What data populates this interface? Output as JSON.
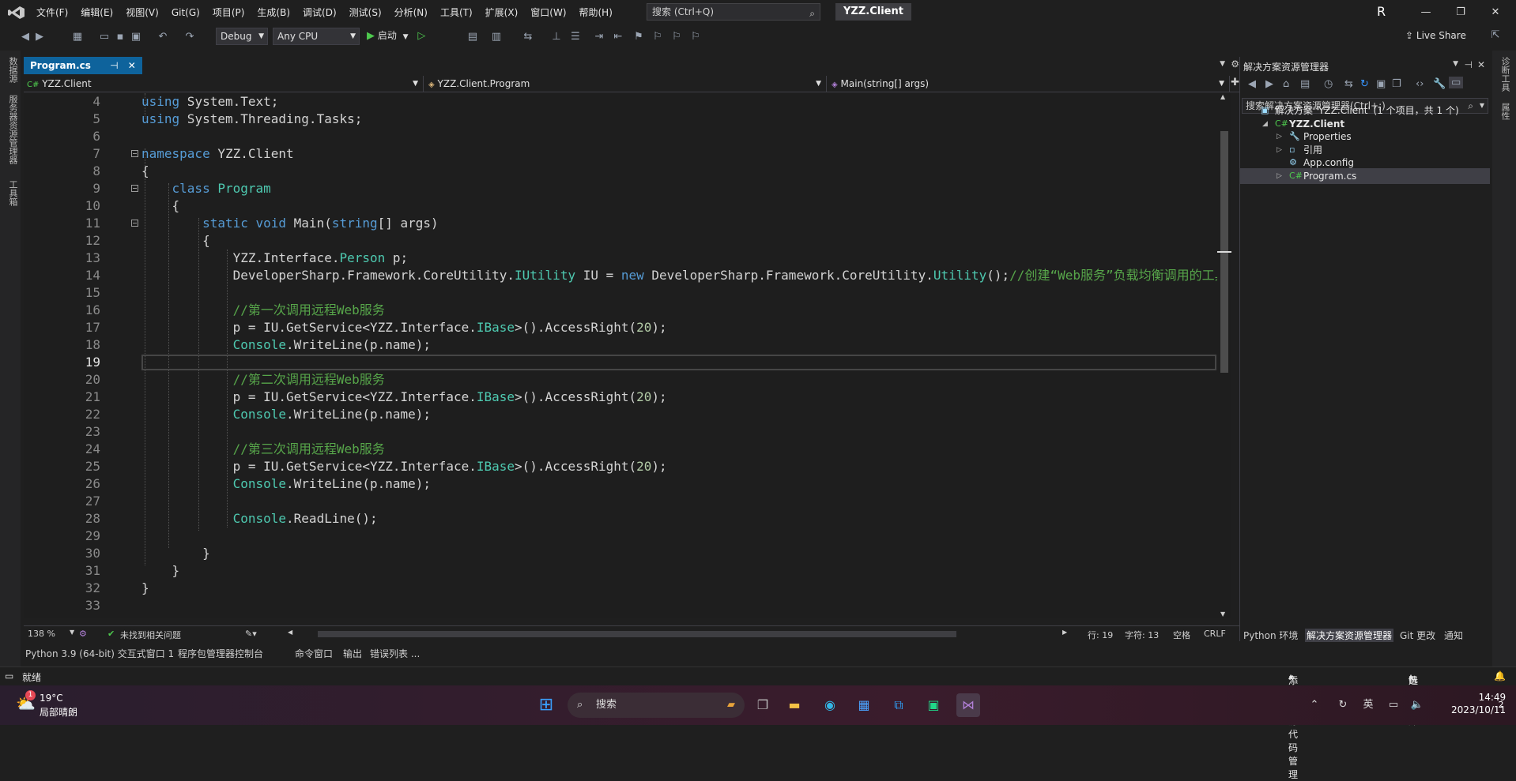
{
  "title_bar": {
    "menu": [
      "文件(F)",
      "编辑(E)",
      "视图(V)",
      "Git(G)",
      "项目(P)",
      "生成(B)",
      "调试(D)",
      "测试(S)",
      "分析(N)",
      "工具(T)",
      "扩展(X)",
      "窗口(W)",
      "帮助(H)"
    ],
    "search_placeholder": "搜索 (Ctrl+Q)",
    "solution_name": "YZZ.Client",
    "user_initial": "R"
  },
  "toolbar": {
    "config": "Debug",
    "platform": "Any CPU",
    "start_label": "启动",
    "live_share": "Live Share"
  },
  "left_rail": [
    "数据源",
    "服务器资源管理器",
    "工具箱"
  ],
  "right_rail": [
    "诊断工具",
    "属性"
  ],
  "editor": {
    "tab_label": "Program.cs",
    "nav_project": "YZZ.Client",
    "nav_class": "YZZ.Client.Program",
    "nav_member": "Main(string[] args)",
    "current_line": 19,
    "lines": [
      {
        "n": 4,
        "segs": [
          [
            "kw",
            "using"
          ],
          [
            "tx",
            " System.Text;"
          ]
        ]
      },
      {
        "n": 5,
        "segs": [
          [
            "kw",
            "using"
          ],
          [
            "tx",
            " System.Threading.Tasks;"
          ]
        ]
      },
      {
        "n": 6,
        "segs": []
      },
      {
        "n": 7,
        "fold": true,
        "segs": [
          [
            "kw",
            "namespace"
          ],
          [
            "tx",
            " YZZ.Client"
          ]
        ]
      },
      {
        "n": 8,
        "segs": [
          [
            "tx",
            "{"
          ]
        ]
      },
      {
        "n": 9,
        "fold": true,
        "segs": [
          [
            "tx",
            "    "
          ],
          [
            "kw",
            "class"
          ],
          [
            "tx",
            " "
          ],
          [
            "ty",
            "Program"
          ]
        ]
      },
      {
        "n": 10,
        "segs": [
          [
            "tx",
            "    {"
          ]
        ]
      },
      {
        "n": 11,
        "fold": true,
        "segs": [
          [
            "tx",
            "        "
          ],
          [
            "kw",
            "static"
          ],
          [
            "tx",
            " "
          ],
          [
            "kw",
            "void"
          ],
          [
            "tx",
            " Main("
          ],
          [
            "kw",
            "string"
          ],
          [
            "tx",
            "[] args)"
          ]
        ]
      },
      {
        "n": 12,
        "segs": [
          [
            "tx",
            "        {"
          ]
        ]
      },
      {
        "n": 13,
        "segs": [
          [
            "tx",
            "            YZZ.Interface."
          ],
          [
            "ty",
            "Person"
          ],
          [
            "tx",
            " p;"
          ]
        ]
      },
      {
        "n": 14,
        "segs": [
          [
            "tx",
            "            DeveloperSharp.Framework.CoreUtility."
          ],
          [
            "ty",
            "IUtility"
          ],
          [
            "tx",
            " IU = "
          ],
          [
            "kw",
            "new"
          ],
          [
            "tx",
            " DeveloperSharp.Framework.CoreUtility."
          ],
          [
            "ty",
            "Utility"
          ],
          [
            "tx",
            "();"
          ],
          [
            "cm",
            "//创建“Web服务”负载均衡调用的工具"
          ]
        ]
      },
      {
        "n": 15,
        "segs": []
      },
      {
        "n": 16,
        "segs": [
          [
            "tx",
            "            "
          ],
          [
            "cm",
            "//第一次调用远程Web服务"
          ]
        ]
      },
      {
        "n": 17,
        "segs": [
          [
            "tx",
            "            p = IU.GetService<YZZ.Interface."
          ],
          [
            "ty",
            "IBase"
          ],
          [
            "tx",
            ">().AccessRight("
          ],
          [
            "nm",
            "20"
          ],
          [
            "tx",
            ");"
          ]
        ]
      },
      {
        "n": 18,
        "segs": [
          [
            "tx",
            "            "
          ],
          [
            "ty",
            "Console"
          ],
          [
            "tx",
            ".WriteLine(p.name);"
          ]
        ]
      },
      {
        "n": 19,
        "segs": []
      },
      {
        "n": 20,
        "segs": [
          [
            "tx",
            "            "
          ],
          [
            "cm",
            "//第二次调用远程Web服务"
          ]
        ]
      },
      {
        "n": 21,
        "segs": [
          [
            "tx",
            "            p = IU.GetService<YZZ.Interface."
          ],
          [
            "ty",
            "IBase"
          ],
          [
            "tx",
            ">().AccessRight("
          ],
          [
            "nm",
            "20"
          ],
          [
            "tx",
            ");"
          ]
        ]
      },
      {
        "n": 22,
        "segs": [
          [
            "tx",
            "            "
          ],
          [
            "ty",
            "Console"
          ],
          [
            "tx",
            ".WriteLine(p.name);"
          ]
        ]
      },
      {
        "n": 23,
        "segs": []
      },
      {
        "n": 24,
        "segs": [
          [
            "tx",
            "            "
          ],
          [
            "cm",
            "//第三次调用远程Web服务"
          ]
        ]
      },
      {
        "n": 25,
        "segs": [
          [
            "tx",
            "            p = IU.GetService<YZZ.Interface."
          ],
          [
            "ty",
            "IBase"
          ],
          [
            "tx",
            ">().AccessRight("
          ],
          [
            "nm",
            "20"
          ],
          [
            "tx",
            ");"
          ]
        ]
      },
      {
        "n": 26,
        "segs": [
          [
            "tx",
            "            "
          ],
          [
            "ty",
            "Console"
          ],
          [
            "tx",
            ".WriteLine(p.name);"
          ]
        ]
      },
      {
        "n": 27,
        "segs": []
      },
      {
        "n": 28,
        "segs": [
          [
            "tx",
            "            "
          ],
          [
            "ty",
            "Console"
          ],
          [
            "tx",
            ".ReadLine();"
          ]
        ]
      },
      {
        "n": 29,
        "segs": []
      },
      {
        "n": 30,
        "segs": [
          [
            "tx",
            "        }"
          ]
        ]
      },
      {
        "n": 31,
        "segs": [
          [
            "tx",
            "    }"
          ]
        ]
      },
      {
        "n": 32,
        "segs": [
          [
            "tx",
            "}"
          ]
        ]
      },
      {
        "n": 33,
        "segs": []
      }
    ],
    "zoom": "138 %",
    "issues": "未找到相关问题",
    "line_info": "行: 19",
    "char_info": "字符: 13",
    "whitespace": "空格",
    "eol": "CRLF"
  },
  "bottom_tabs": [
    "Python 3.9 (64-bit) 交互式窗口 1",
    "程序包管理器控制台",
    "命令窗口",
    "输出",
    "错误列表 ..."
  ],
  "solution_explorer": {
    "title": "解决方案资源管理器",
    "search_placeholder": "搜索解决方案资源管理器(Ctrl+;)",
    "items": [
      {
        "label": "解决方案 'YZZ.Client' (1 个项目，共 1 个)",
        "indent": 0,
        "icon": "▣"
      },
      {
        "label": "YZZ.Client",
        "indent": 1,
        "icon": "C#",
        "bold": true,
        "expanded": true
      },
      {
        "label": "Properties",
        "indent": 2,
        "icon": "🔧",
        "twisty": true
      },
      {
        "label": "引用",
        "indent": 2,
        "icon": "▫",
        "twisty": true
      },
      {
        "label": "App.config",
        "indent": 2,
        "icon": "⚙"
      },
      {
        "label": "Program.cs",
        "indent": 2,
        "icon": "C#",
        "twisty": true,
        "selected": true
      }
    ],
    "bottom_tabs": [
      "Python 环境",
      "解决方案资源管理器",
      "Git 更改",
      "通知"
    ]
  },
  "status_bar": {
    "ready": "就绪",
    "add_source": "添加到源代码管理",
    "select_repo": "选择仓库"
  },
  "taskbar": {
    "temp": "19°C",
    "weather": "局部晴朗",
    "weather_badge": "1",
    "search": "搜索",
    "lang": "英",
    "time": "14:49",
    "date": "2023/10/11",
    "notif": "2"
  }
}
